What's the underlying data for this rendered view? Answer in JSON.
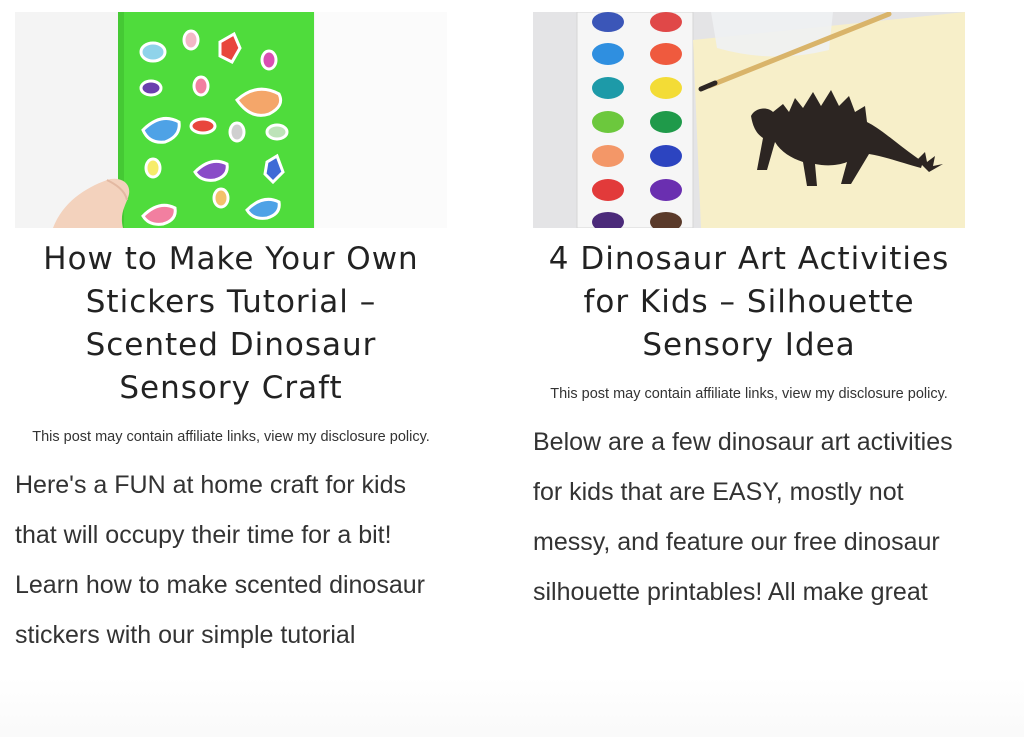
{
  "posts": [
    {
      "title": "How to Make Your Own Stickers Tutorial – Scented Dinosaur Sensory Craft",
      "disclosure": "This post may contain affiliate links, view my disclosure policy.",
      "excerpt": "Here's a FUN at home craft for kids that will occupy their time for a bit! Learn how to make scented dinosaur stickers with our simple tutorial"
    },
    {
      "title": "4 Dinosaur Art Activities for Kids – Silhouette Sensory Idea",
      "disclosure": "This post may contain affiliate links, view my disclosure policy.",
      "excerpt": "Below are a few dinosaur art activities for kids that are EASY, mostly not messy, and feature our free dinosaur silhouette printables! All make great"
    }
  ],
  "colors": {
    "sticker_sheet": "#4fdc3c",
    "paper": "#f7efc9",
    "silhouette": "#2c2522",
    "text": "#333333"
  }
}
